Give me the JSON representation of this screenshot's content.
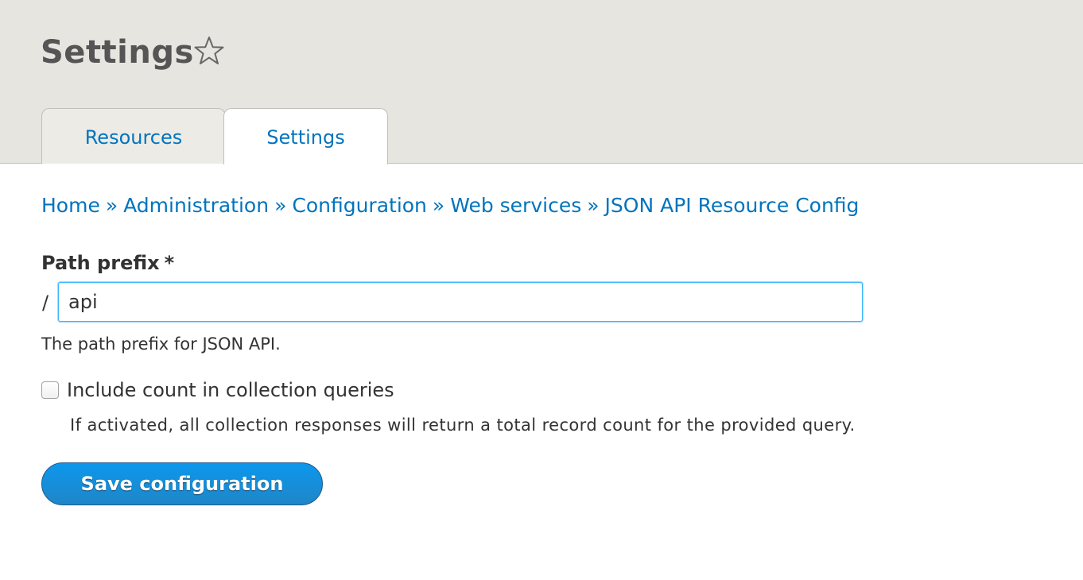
{
  "header": {
    "title": "Settings",
    "shortcut_icon": "star-outline-icon",
    "background": "#e6e5e0"
  },
  "tabs": [
    {
      "label": "Resources",
      "active": false
    },
    {
      "label": "Settings",
      "active": true
    }
  ],
  "breadcrumb": {
    "separator": "»",
    "items": [
      "Home",
      "Administration",
      "Configuration",
      "Web services",
      "JSON API Resource Config"
    ]
  },
  "form": {
    "path_prefix": {
      "label": "Path prefix",
      "required_mark": "*",
      "prefix": "/",
      "value": "api",
      "description": "The path prefix for JSON API."
    },
    "include_count": {
      "label": "Include count in collection queries",
      "checked": false,
      "description": "If activated, all collection responses will return a total record count for the provided query."
    },
    "submit_label": "Save configuration"
  },
  "colors": {
    "link": "#0074bd",
    "button": "#1a8ad4",
    "focus": "#40b6ff"
  }
}
